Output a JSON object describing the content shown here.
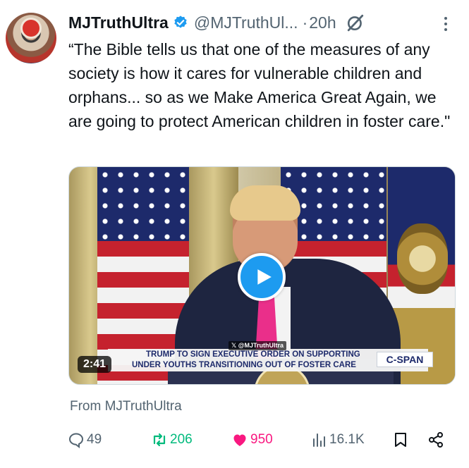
{
  "tweet": {
    "display_name": "MJTruthUltra",
    "handle": "@MJTruthUl...",
    "separator": "·",
    "time": "20h",
    "text": "“The Bible tells us that one of the measures of any society is how it cares for vulnerable children and orphans... so as we Make America Great Again, we are going to protect American children in foster care.\""
  },
  "video": {
    "duration": "2:41",
    "watermark": "𝕏 @MJTruthUltra",
    "chyron_line1": "TRUMP TO SIGN EXECUTIVE ORDER ON SUPPORTING",
    "chyron_line2": "UNDER YOUTHS TRANSITIONING OUT OF FOSTER CARE",
    "network": "C-SPAN"
  },
  "source": "From MJTruthUltra",
  "actions": {
    "replies": "49",
    "retweets": "206",
    "likes": "950",
    "views": "16.1K"
  },
  "colors": {
    "accent": "#1d9bf0",
    "retweet": "#00ba7c",
    "like": "#f91880",
    "muted": "#536471"
  },
  "icons": [
    "verified-badge-icon",
    "grok-icon",
    "more-icon",
    "play-icon",
    "reply-icon",
    "retweet-icon",
    "like-icon",
    "views-icon",
    "bookmark-icon",
    "share-icon"
  ]
}
